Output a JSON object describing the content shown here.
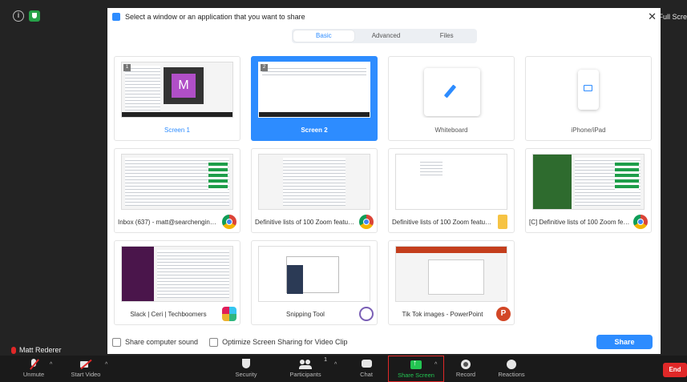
{
  "window": {
    "fullscreen_label": "Full Scre"
  },
  "dialog": {
    "title": "Select a window or an application that you want to share",
    "tabs": [
      {
        "label": "Basic",
        "active": true
      },
      {
        "label": "Advanced",
        "active": false
      },
      {
        "label": "Files",
        "active": false
      }
    ],
    "tiles": [
      {
        "label": "Screen 1",
        "kind": "screen",
        "tag": "1",
        "thumb_letter": "M"
      },
      {
        "label": "Screen 2",
        "kind": "screen",
        "tag": "2",
        "selected": true
      },
      {
        "label": "Whiteboard",
        "kind": "whiteboard"
      },
      {
        "label": "iPhone/iPad",
        "kind": "device"
      },
      {
        "label": "Inbox (637) - matt@searchenginejournal.com",
        "kind": "window",
        "badge": "chrome-icon"
      },
      {
        "label": "Definitive lists of 100 Zoom features",
        "kind": "window",
        "badge": "chrome-icon"
      },
      {
        "label": "Definitive lists of 100 Zoom features",
        "kind": "window",
        "badge": "folder-icon"
      },
      {
        "label": "[C] Definitive lists of 100 Zoom features",
        "kind": "window",
        "badge": "chrome-icon"
      },
      {
        "label": "Slack | Ceri | Techboomers",
        "kind": "window",
        "badge": "slack-icon"
      },
      {
        "label": "Snipping Tool",
        "kind": "window",
        "badge": "scissors-icon"
      },
      {
        "label": "Tik Tok images - PowerPoint",
        "kind": "window",
        "badge": "powerpoint-icon",
        "badge_letter": "P"
      }
    ],
    "share_computer_sound": "Share computer sound",
    "optimize_video": "Optimize Screen Sharing for Video Clip",
    "share_button": "Share"
  },
  "participant": {
    "name": "Matt Rederer"
  },
  "toolbar": {
    "unmute": "Unmute",
    "start_video": "Start Video",
    "security": "Security",
    "participants": "Participants",
    "participants_count": "1",
    "chat": "Chat",
    "share_screen": "Share Screen",
    "record": "Record",
    "reactions": "Reactions",
    "end": "End"
  },
  "colors": {
    "accent": "#2d8cff",
    "share_green": "#23c552",
    "end_red": "#e02828"
  }
}
